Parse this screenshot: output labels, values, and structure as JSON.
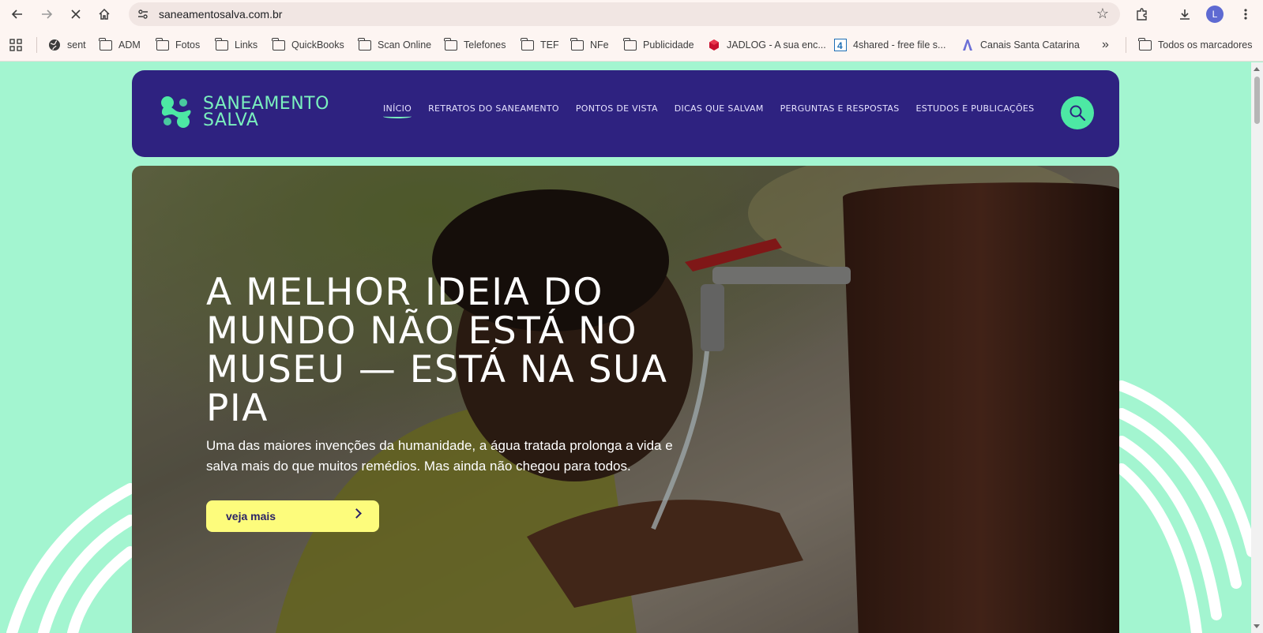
{
  "browser": {
    "url": "saneamentosalva.com.br",
    "avatar_letter": "L",
    "bookmarks": [
      {
        "label": "sent",
        "icon": "globe-icon"
      },
      {
        "label": "ADM",
        "icon": "folder-icon"
      },
      {
        "label": "Fotos",
        "icon": "folder-icon"
      },
      {
        "label": "Links",
        "icon": "folder-icon"
      },
      {
        "label": "QuickBooks",
        "icon": "folder-icon"
      },
      {
        "label": "Scan Online",
        "icon": "folder-icon"
      },
      {
        "label": "Telefones",
        "icon": "folder-icon"
      },
      {
        "label": "TEF",
        "icon": "folder-icon"
      },
      {
        "label": "NFe",
        "icon": "folder-icon"
      },
      {
        "label": "Publicidade",
        "icon": "folder-icon"
      },
      {
        "label": "JADLOG - A sua enc...",
        "icon": "jadlog-icon"
      },
      {
        "label": "4shared - free file s...",
        "icon": "4shared-icon"
      },
      {
        "label": "Canais Santa Catarina",
        "icon": "canais-icon"
      }
    ],
    "more_label": "»",
    "all_bookmarks": "Todos os marcadores"
  },
  "site": {
    "logo_line1": "SANEAMENTO",
    "logo_line2": "SALVA",
    "nav": [
      {
        "label": "INÍCIO",
        "active": true
      },
      {
        "label": "RETRATOS DO SANEAMENTO",
        "active": false
      },
      {
        "label": "PONTOS DE VISTA",
        "active": false
      },
      {
        "label": "DICAS QUE SALVAM",
        "active": false
      },
      {
        "label": "PERGUNTAS E RESPOSTAS",
        "active": false
      },
      {
        "label": "ESTUDOS E PUBLICAÇÕES",
        "active": false
      }
    ]
  },
  "hero": {
    "title": "A MELHOR IDEIA DO MUNDO NÃO ESTÁ NO MUSEU — ESTÁ NA SUA PIA",
    "subtitle": "Uma das maiores invenções da humanidade, a água tratada prolonga a vida e salva mais do que muitos remédios. Mas ainda não chegou para todos.",
    "cta_label": "veja mais"
  },
  "colors": {
    "page_bg": "#a3f5d0",
    "header_bg": "#2e2280",
    "accent_green": "#4de8a4",
    "cta_yellow": "#fdfc7c"
  }
}
